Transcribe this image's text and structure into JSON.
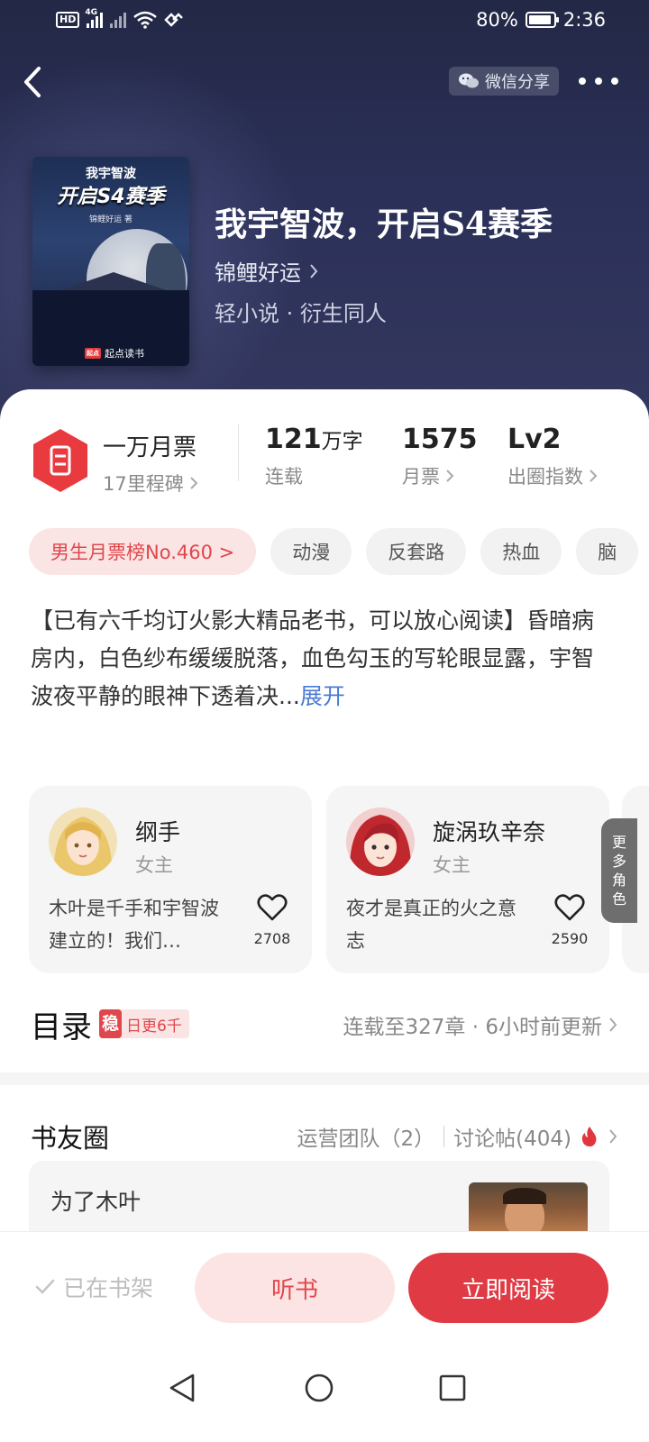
{
  "status_bar": {
    "hd": "HD",
    "net": "4G",
    "battery": "80%",
    "time": "2:36"
  },
  "header": {
    "share_label": "微信分享"
  },
  "book": {
    "cover_line1": "我宇智波",
    "cover_line2": "开启S4赛季",
    "cover_author": "锦鲤好运 著",
    "cover_brand_badge": "起点",
    "cover_brand": "起点读书",
    "title": "我宇智波，开启S4赛季",
    "author": "锦鲤好运",
    "genre": "轻小说 · 衍生同人"
  },
  "stats": {
    "milestone": "一万月票",
    "milestone_sub": "17里程碑",
    "words_value": "121",
    "words_unit": "万字",
    "words_label": "连载",
    "tickets_value": "1575",
    "tickets_label": "月票",
    "level_value": "Lv2",
    "level_label": "出圈指数"
  },
  "tags": [
    "男生月票榜No.460 >",
    "动漫",
    "反套路",
    "热血",
    "脑"
  ],
  "description": {
    "text": "【已有六千均订火影大精品老书，可以放心阅读】昏暗病房内，白色纱布缓缓脱落，血色勾玉的写轮眼显露，宇智波夜平静的眼神下透着决...",
    "expand": "展开"
  },
  "characters": [
    {
      "name": "纲手",
      "role": "女主",
      "desc": "木叶是千手和宇智波建立的！我们…",
      "likes": "2708"
    },
    {
      "name": "旋涡玖辛奈",
      "role": "女主",
      "desc": "夜才是真正的火之意志",
      "likes": "2590"
    }
  ],
  "more_roles": "更多角色",
  "toc": {
    "title": "目录",
    "badge_icon": "稳",
    "badge_text": "日更6千",
    "status": "连载至327章 · 6小时前更新"
  },
  "circle": {
    "title": "书友圈",
    "team": "运营团队（2）",
    "posts": "讨论帖(404)",
    "post_title": "为了木叶"
  },
  "actions": {
    "shelf": "已在书架",
    "listen": "听书",
    "read": "立即阅读"
  },
  "colors": {
    "accent_red": "#e03a45",
    "header_bg": "#2b3058",
    "link_blue": "#4a7bd6"
  }
}
